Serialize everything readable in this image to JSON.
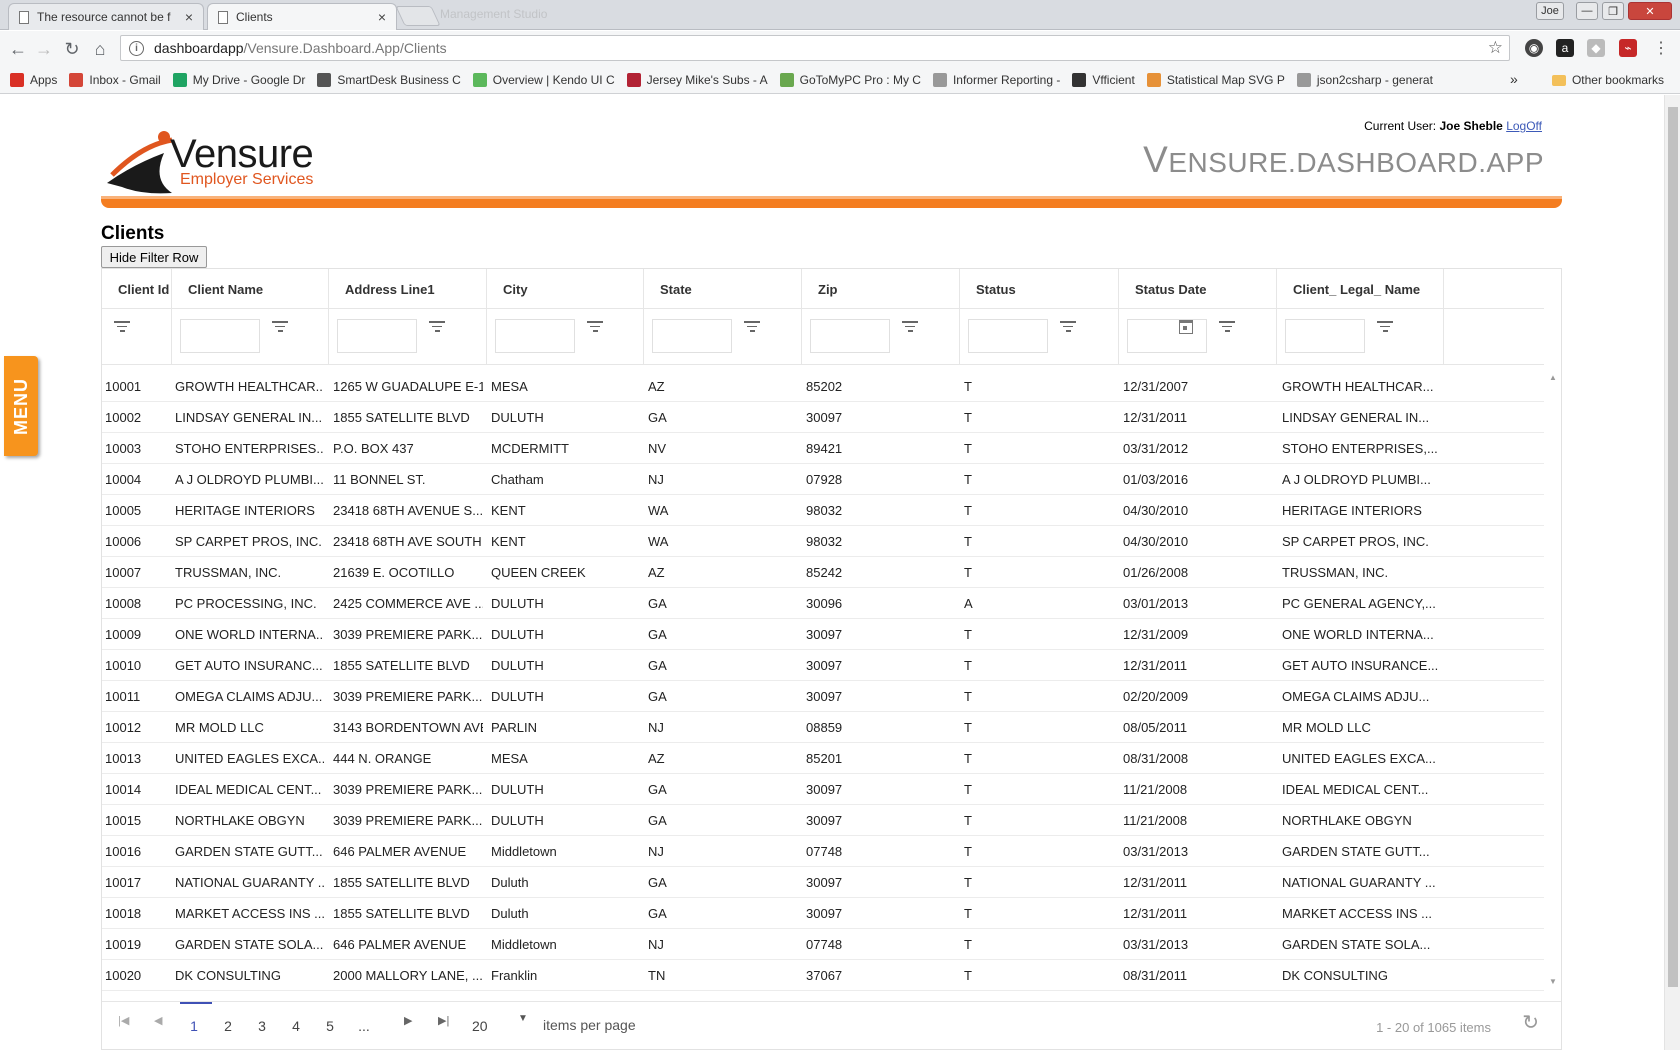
{
  "browser": {
    "tabs": [
      {
        "title": "The resource cannot be f",
        "close": "×"
      },
      {
        "title": "Clients",
        "close": "×"
      }
    ],
    "ghost_tab": "Management Studio",
    "url_host": "dashboardapp",
    "url_path": "/Vensure.Dashboard.App/Clients",
    "window_user": "Joe",
    "bookmarks": [
      {
        "label": "Apps",
        "icon": "apps-grid-icon",
        "color": "#d93025"
      },
      {
        "label": "Inbox - Gmail",
        "icon": "gmail-icon",
        "color": "#d44638"
      },
      {
        "label": "My Drive - Google Dr",
        "icon": "google-drive-icon",
        "color": "#1fa463"
      },
      {
        "label": "SmartDesk Business C",
        "icon": "lambda-icon",
        "color": "#555555"
      },
      {
        "label": "Overview | Kendo UI C",
        "icon": "kendo-icon",
        "color": "#5cb85c"
      },
      {
        "label": "Jersey Mike's Subs - A",
        "icon": "flag-icon",
        "color": "#b22234"
      },
      {
        "label": "GoToMyPC Pro : My C",
        "icon": "gotomypc-icon",
        "color": "#6aa84f"
      },
      {
        "label": "Informer Reporting -",
        "icon": "page-icon",
        "color": "#999999"
      },
      {
        "label": "Vfficient",
        "icon": "lambda-icon",
        "color": "#333333"
      },
      {
        "label": "Statistical Map SVG P",
        "icon": "map-icon",
        "color": "#e69138"
      },
      {
        "label": "json2csharp - generat",
        "icon": "page-icon",
        "color": "#999999"
      }
    ],
    "overflow": "»",
    "other_bookmarks": "Other bookmarks"
  },
  "menu_tab": "MENU",
  "header": {
    "current_user_label": "Current User:",
    "current_user_name": "Joe Sheble",
    "logoff": "LogOff",
    "logo_name": "Vensure",
    "logo_tagline": "Employer Services",
    "app_title_first": "V",
    "app_title_rest": "ENSURE.DASHBOARD.APP"
  },
  "page_title": "Clients",
  "hide_filter_label": "Hide Filter Row",
  "grid": {
    "columns": [
      "Client Id",
      "Client Name",
      "Address Line1",
      "City",
      "State",
      "Zip",
      "Status",
      "Status Date",
      "Client_ Legal_ Name"
    ],
    "rows": [
      [
        "10001",
        "GROWTH HEALTHCAR...",
        "1265 W GUADALUPE E-1",
        "MESA",
        "AZ",
        "85202",
        "T",
        "12/31/2007",
        "GROWTH HEALTHCAR..."
      ],
      [
        "10002",
        "LINDSAY GENERAL IN...",
        "1855 SATELLITE BLVD",
        "DULUTH",
        "GA",
        "30097",
        "T",
        "12/31/2011",
        "LINDSAY GENERAL IN..."
      ],
      [
        "10003",
        "STOHO ENTERPRISES...",
        "P.O. BOX 437",
        "MCDERMITT",
        "NV",
        "89421",
        "T",
        "03/31/2012",
        "STOHO ENTERPRISES,..."
      ],
      [
        "10004",
        "A J OLDROYD PLUMBI...",
        "11 BONNEL ST.",
        "Chatham",
        "NJ",
        "07928",
        "T",
        "01/03/2016",
        "A J OLDROYD PLUMBI..."
      ],
      [
        "10005",
        "HERITAGE INTERIORS",
        "23418 68TH AVENUE S...",
        "KENT",
        "WA",
        "98032",
        "T",
        "04/30/2010",
        "HERITAGE INTERIORS"
      ],
      [
        "10006",
        "SP CARPET PROS, INC.",
        "23418 68TH AVE SOUTH",
        "KENT",
        "WA",
        "98032",
        "T",
        "04/30/2010",
        "SP CARPET PROS, INC."
      ],
      [
        "10007",
        "TRUSSMAN, INC.",
        "21639 E. OCOTILLO",
        "QUEEN CREEK",
        "AZ",
        "85242",
        "T",
        "01/26/2008",
        "TRUSSMAN, INC."
      ],
      [
        "10008",
        "PC PROCESSING, INC.",
        "2425 COMMERCE AVE ...",
        "DULUTH",
        "GA",
        "30096",
        "A",
        "03/01/2013",
        "PC GENERAL AGENCY,..."
      ],
      [
        "10009",
        "ONE WORLD INTERNA...",
        "3039 PREMIERE PARK...",
        "DULUTH",
        "GA",
        "30097",
        "T",
        "12/31/2009",
        "ONE WORLD INTERNA..."
      ],
      [
        "10010",
        "GET AUTO INSURANC...",
        "1855 SATELLITE BLVD",
        "DULUTH",
        "GA",
        "30097",
        "T",
        "12/31/2011",
        "GET AUTO INSURANCE..."
      ],
      [
        "10011",
        "OMEGA CLAIMS ADJU...",
        "3039 PREMIERE PARK...",
        "DULUTH",
        "GA",
        "30097",
        "T",
        "02/20/2009",
        "OMEGA CLAIMS ADJU..."
      ],
      [
        "10012",
        "MR MOLD LLC",
        "3143 BORDENTOWN AVE",
        "PARLIN",
        "NJ",
        "08859",
        "T",
        "08/05/2011",
        "MR MOLD LLC"
      ],
      [
        "10013",
        "UNITED EAGLES EXCA...",
        "444 N. ORANGE",
        "MESA",
        "AZ",
        "85201",
        "T",
        "08/31/2008",
        "UNITED EAGLES EXCA..."
      ],
      [
        "10014",
        "IDEAL MEDICAL CENT...",
        "3039 PREMIERE PARK...",
        "DULUTH",
        "GA",
        "30097",
        "T",
        "11/21/2008",
        "IDEAL MEDICAL CENT..."
      ],
      [
        "10015",
        "NORTHLAKE OBGYN",
        "3039 PREMIERE PARK...",
        "DULUTH",
        "GA",
        "30097",
        "T",
        "11/21/2008",
        "NORTHLAKE OBGYN"
      ],
      [
        "10016",
        "GARDEN STATE GUTT...",
        "646 PALMER AVENUE",
        "Middletown",
        "NJ",
        "07748",
        "T",
        "03/31/2013",
        "GARDEN STATE GUTT..."
      ],
      [
        "10017",
        "NATIONAL GUARANTY ...",
        "1855 SATELLITE BLVD",
        "Duluth",
        "GA",
        "30097",
        "T",
        "12/31/2011",
        "NATIONAL GUARANTY ..."
      ],
      [
        "10018",
        "MARKET ACCESS INS ...",
        "1855 SATELLITE BLVD",
        "Duluth",
        "GA",
        "30097",
        "T",
        "12/31/2011",
        "MARKET ACCESS INS ..."
      ],
      [
        "10019",
        "GARDEN STATE SOLA...",
        "646 PALMER AVENUE",
        "Middletown",
        "NJ",
        "07748",
        "T",
        "03/31/2013",
        "GARDEN STATE SOLA..."
      ],
      [
        "10020",
        "DK CONSULTING",
        "2000 MALLORY LANE, ...",
        "Franklin",
        "TN",
        "37067",
        "T",
        "08/31/2011",
        "DK CONSULTING"
      ]
    ]
  },
  "pager": {
    "pages": [
      "1",
      "2",
      "3",
      "4",
      "5",
      "..."
    ],
    "current_page": "1",
    "page_size": "20",
    "items_per_page_label": "items per page",
    "info": "1 - 20 of 1065 items"
  },
  "colors": {
    "accent": "#f47d20",
    "menu_tab": "#f7941d",
    "pager_current": "#3f51b5"
  }
}
